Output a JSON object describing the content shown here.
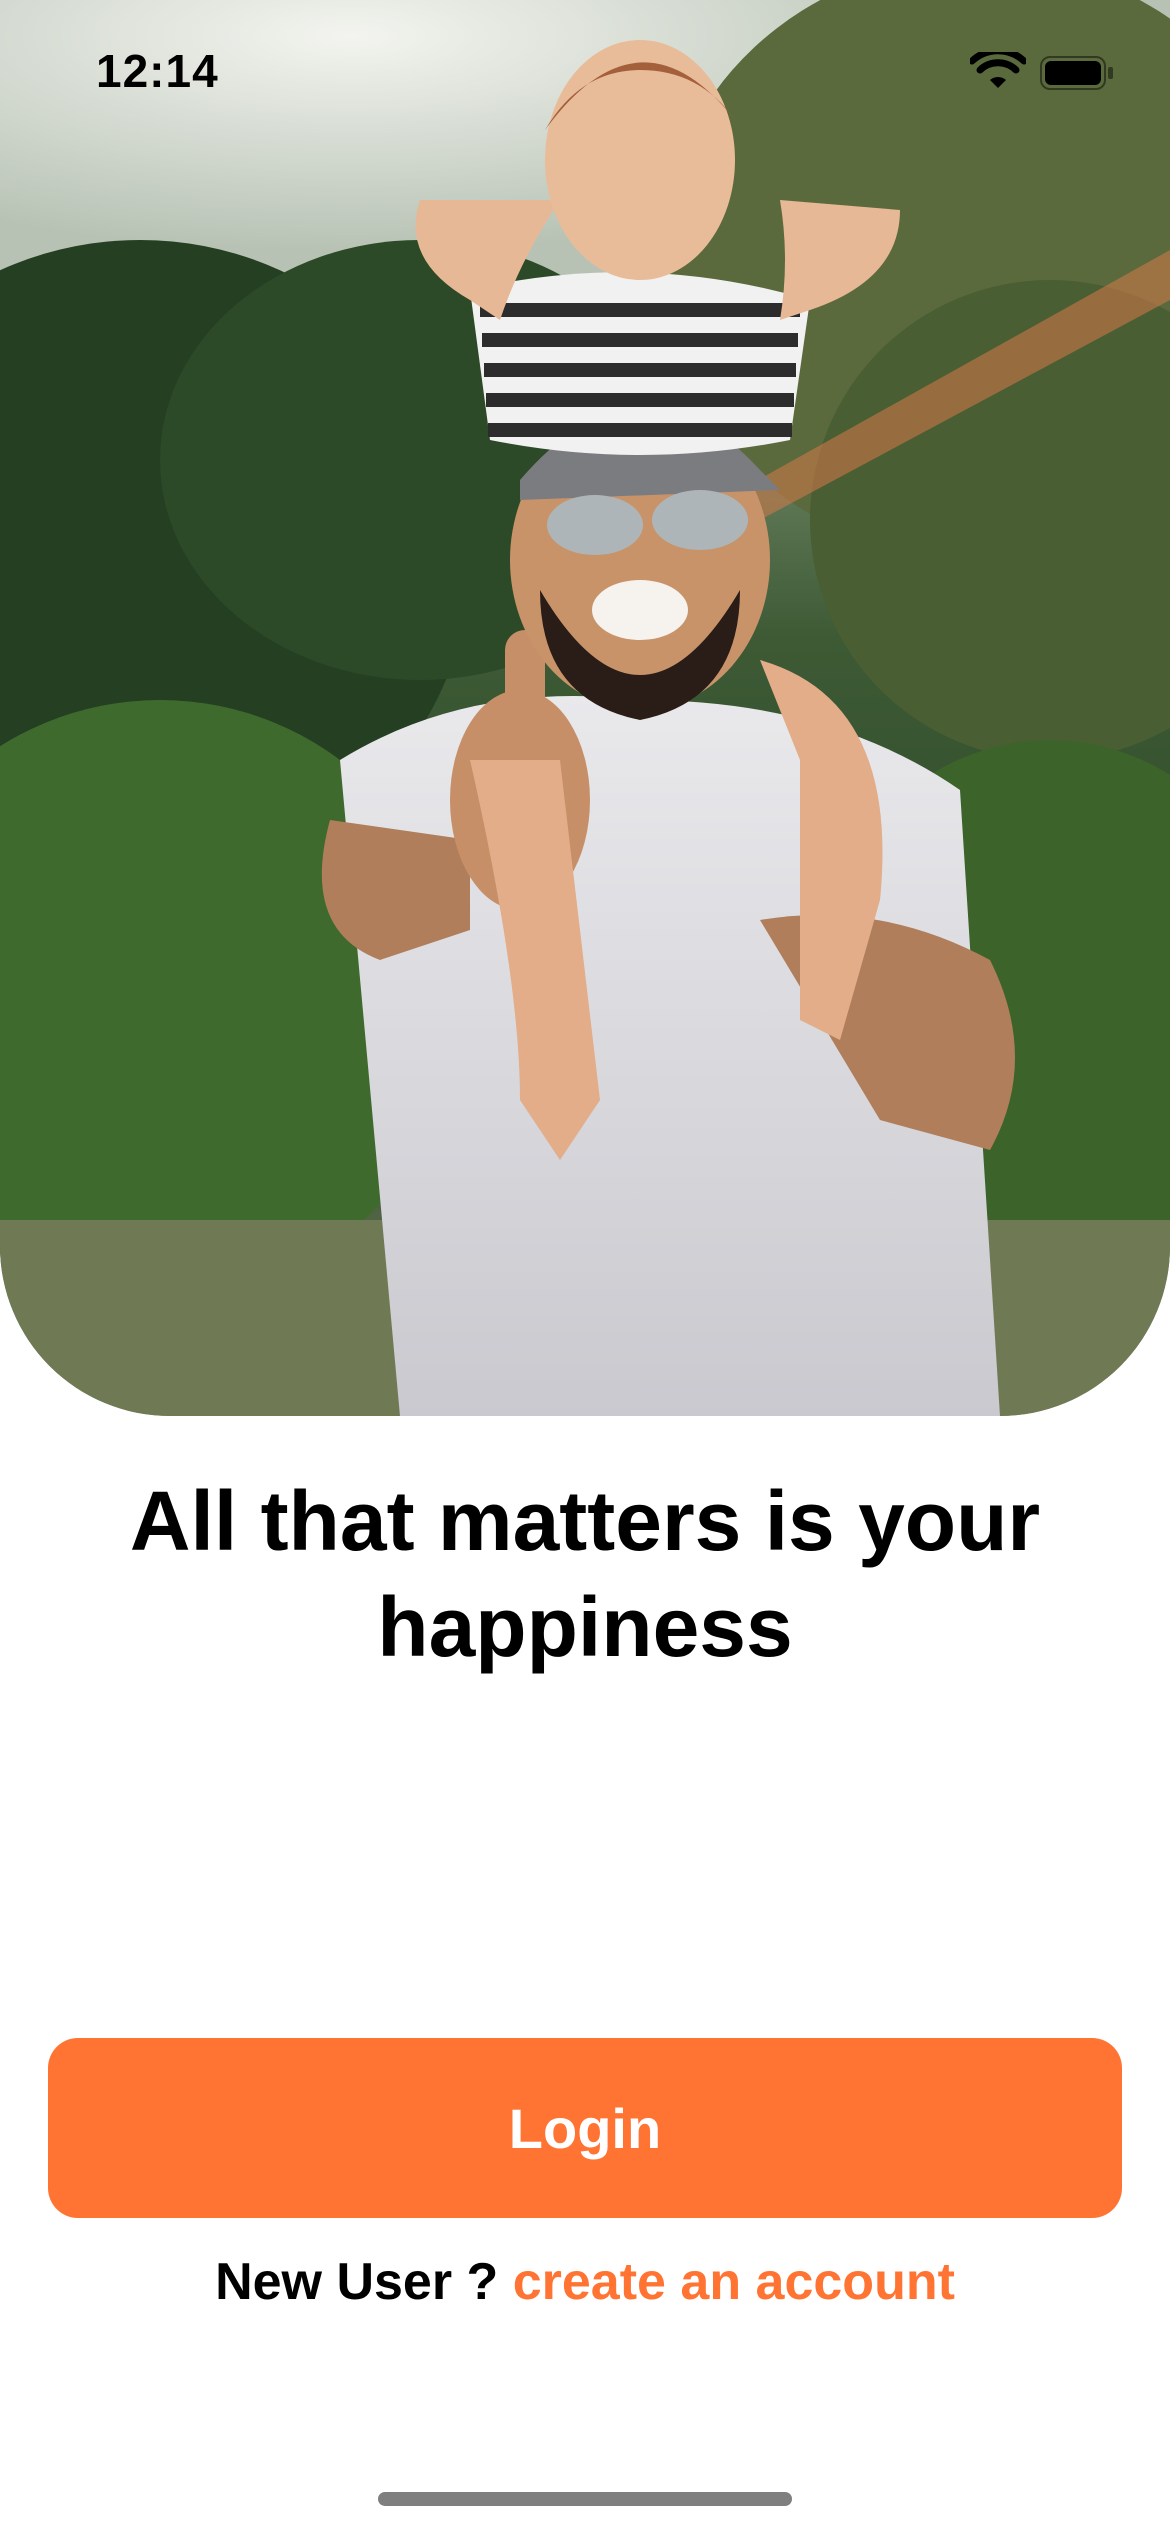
{
  "status_bar": {
    "time": "12:14",
    "wifi_icon": "wifi-icon",
    "battery_icon": "battery-icon"
  },
  "hero": {
    "image": "photo of smiling bearded man with sunglasses and cap giving thumbs up while carrying a child on his shoulders, green hedges behind"
  },
  "headline": {
    "line1": "All that matters is your",
    "line2": "happiness"
  },
  "login_button": {
    "label": "Login"
  },
  "signup": {
    "prefix": "New User ?",
    "link": "create an account"
  },
  "colors": {
    "accent": "#ff7433",
    "text": "#000000",
    "background": "#ffffff",
    "home_indicator": "#7f7f7f"
  }
}
